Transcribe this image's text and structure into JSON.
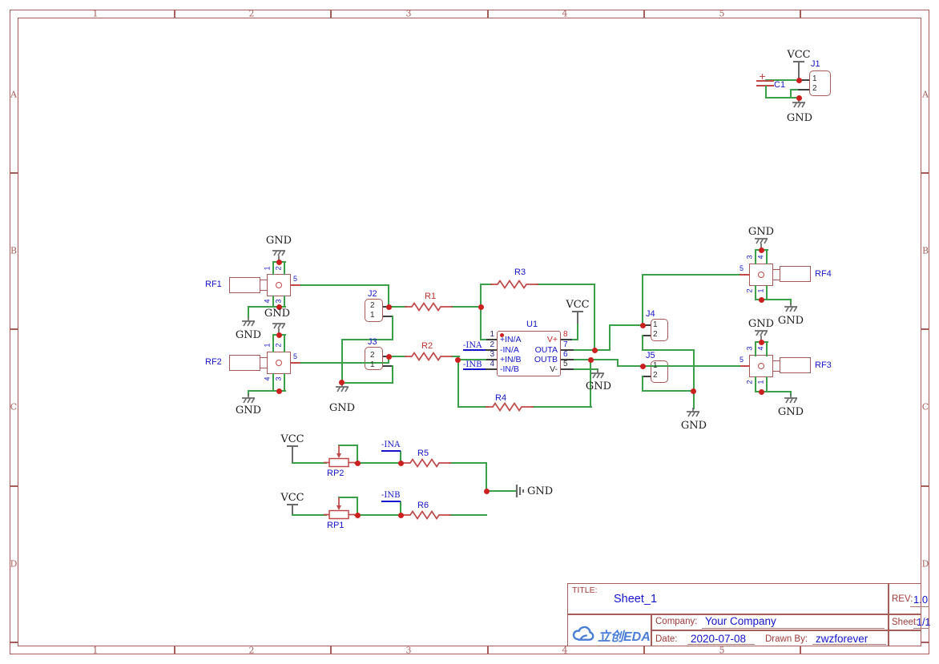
{
  "frame": {
    "cols": [
      "1",
      "2",
      "3",
      "4",
      "5"
    ],
    "rows": [
      "A",
      "B",
      "C",
      "D"
    ]
  },
  "power": {
    "vcc": "VCC",
    "gnd": "GND"
  },
  "nets": {
    "ina": "-INA",
    "inb": "-INB"
  },
  "parts": {
    "c1": {
      "ref": "C1",
      "plus": "+"
    },
    "j1": {
      "ref": "J1"
    },
    "j2": {
      "ref": "J2"
    },
    "j3": {
      "ref": "J3"
    },
    "j4": {
      "ref": "J4"
    },
    "j5": {
      "ref": "J5"
    },
    "jpins": {
      "p1": "1",
      "p2": "2"
    },
    "rfpins": {
      "p1": "1",
      "p2": "2",
      "p3": "3",
      "p4": "4",
      "p5": "5"
    },
    "r1": {
      "ref": "R1"
    },
    "r2": {
      "ref": "R2"
    },
    "r3": {
      "ref": "R3"
    },
    "r4": {
      "ref": "R4"
    },
    "r5": {
      "ref": "R5"
    },
    "r6": {
      "ref": "R6"
    },
    "rp1": {
      "ref": "RP1"
    },
    "rp2": {
      "ref": "RP2"
    },
    "rf1": {
      "ref": "RF1"
    },
    "rf2": {
      "ref": "RF2"
    },
    "rf3": {
      "ref": "RF3"
    },
    "rf4": {
      "ref": "RF4"
    },
    "u1": {
      "ref": "U1",
      "left": [
        {
          "num": "1",
          "name": "+IN/A"
        },
        {
          "num": "2",
          "name": "-IN/A"
        },
        {
          "num": "3",
          "name": "+IN/B"
        },
        {
          "num": "4",
          "name": "-IN/B"
        }
      ],
      "right": [
        {
          "num": "8",
          "name": "V+"
        },
        {
          "num": "7",
          "name": "OUTA"
        },
        {
          "num": "6",
          "name": "OUTB"
        },
        {
          "num": "5",
          "name": "V-"
        }
      ]
    }
  },
  "tb": {
    "title_label": "TITLE:",
    "title": "Sheet_1",
    "rev_label": "REV:",
    "rev": "1.0",
    "company_label": "Company:",
    "company": "Your Company",
    "sheet_label": "Sheet:",
    "sheet": "1/1",
    "date_label": "Date:",
    "date": "2020-07-08",
    "drawn_label": "Drawn By:",
    "drawn": "zwzforever",
    "logo": "立创EDA"
  }
}
